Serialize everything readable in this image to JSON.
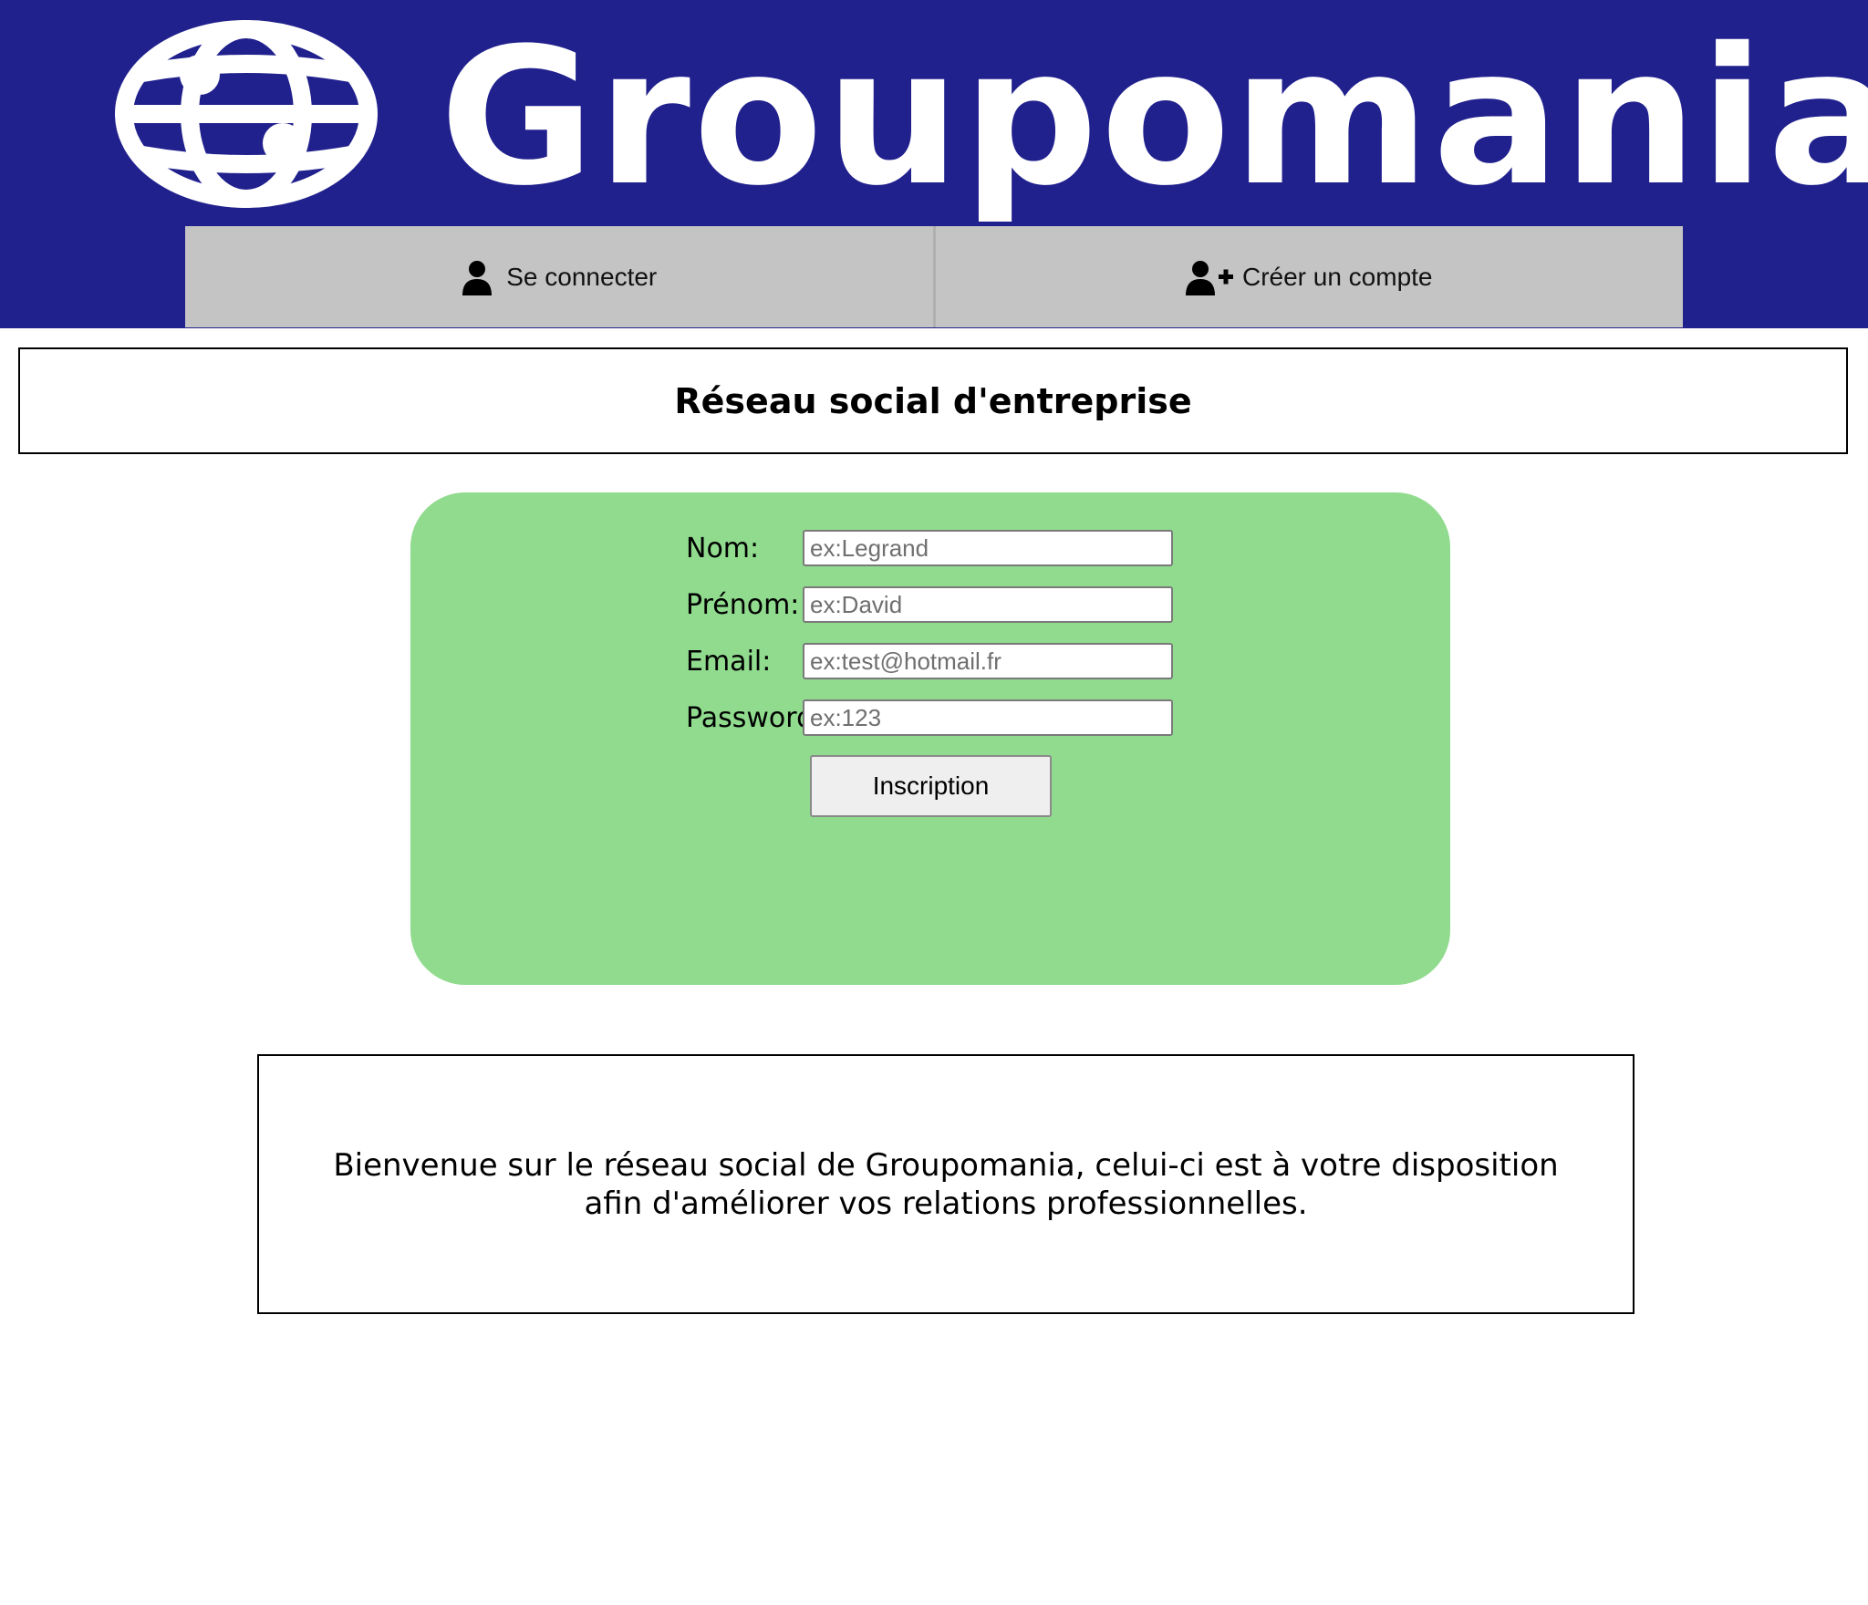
{
  "brand": {
    "name": "Groupomania",
    "colors": {
      "header_bg": "#21218e",
      "nav_bg": "#c4c4c4",
      "form_bg": "#90db8e"
    }
  },
  "nav": {
    "login": {
      "label": "Se connecter",
      "icon": "user-icon"
    },
    "signup": {
      "label": "Créer un compte",
      "icon": "user-plus-icon"
    }
  },
  "page": {
    "title": "Réseau social d'entreprise"
  },
  "form": {
    "nom": {
      "label": "Nom:",
      "placeholder": "ex:Legrand",
      "value": ""
    },
    "prenom": {
      "label": "Prénom:",
      "placeholder": "ex:David",
      "value": ""
    },
    "email": {
      "label": "Email:",
      "placeholder": "ex:test@hotmail.fr",
      "value": ""
    },
    "password": {
      "label": "Password",
      "placeholder": "ex:123",
      "value": ""
    },
    "submit_label": "Inscription"
  },
  "welcome": {
    "text": "Bienvenue sur le réseau social de Groupomania, celui-ci est à votre disposition afin d'améliorer vos relations professionnelles."
  }
}
